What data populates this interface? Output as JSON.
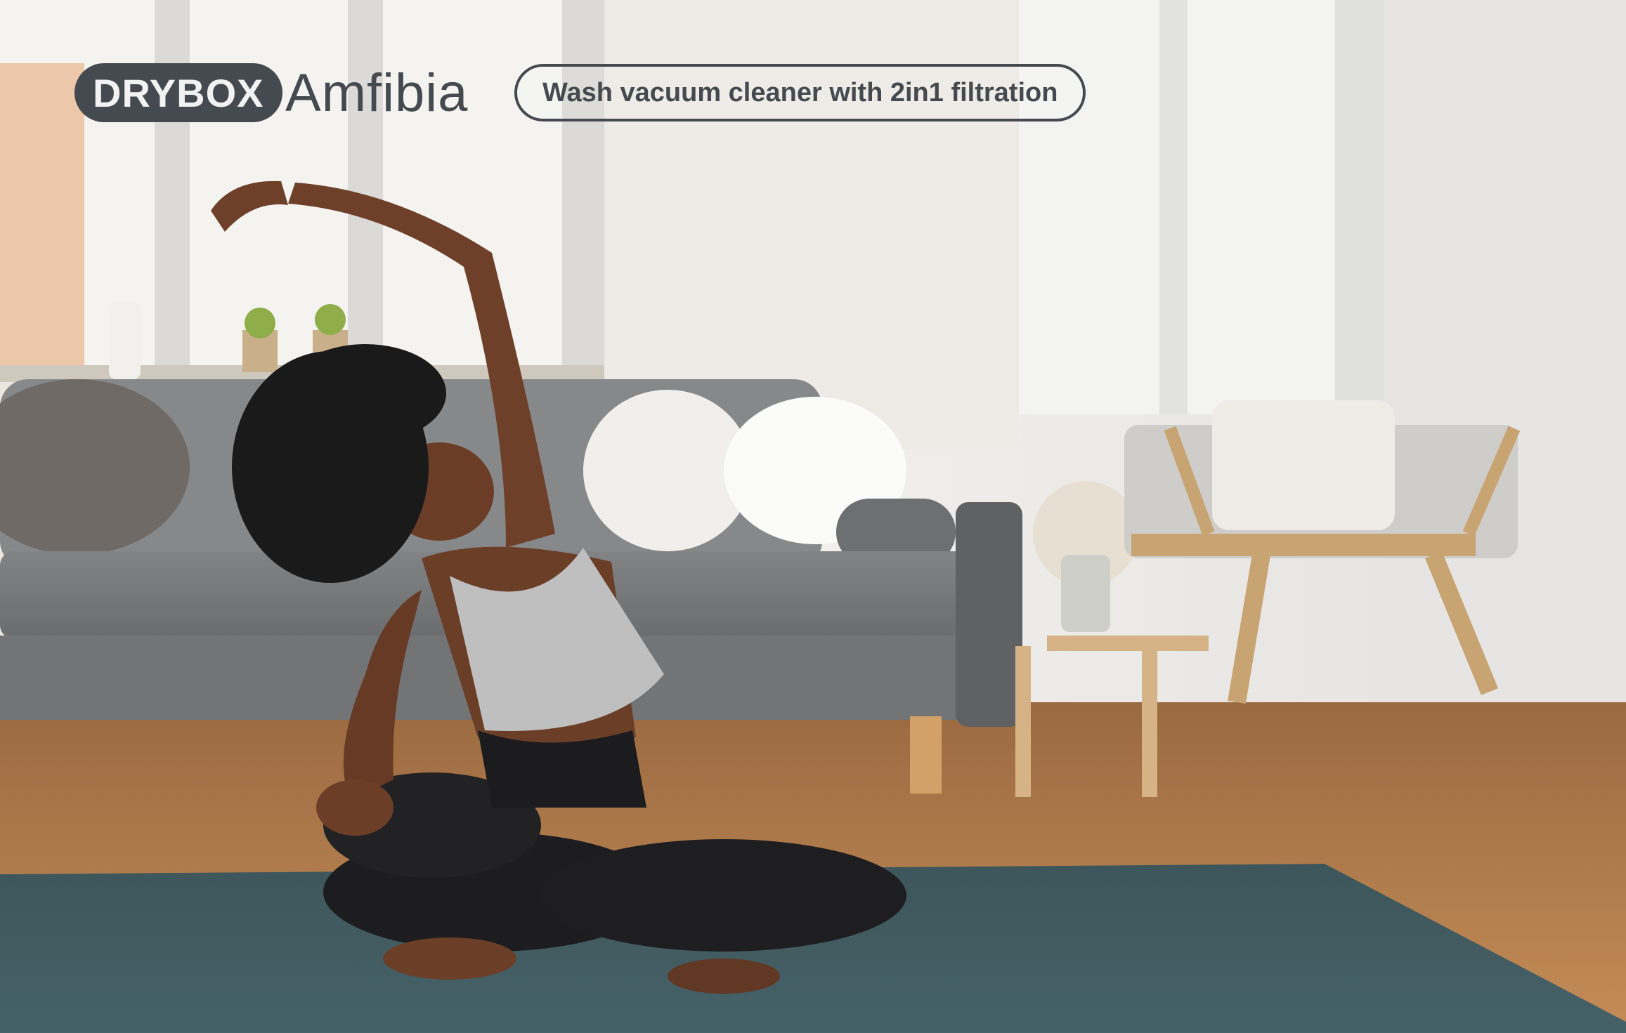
{
  "header": {
    "brand": "DRYBOX",
    "product": "Amfibia",
    "tagline": "Wash vacuum cleaner with 2in1 filtration"
  },
  "colors": {
    "brand_pill_bg": "#454a50",
    "brand_pill_text": "#f2f2f2",
    "text_dark": "#454a50",
    "mat": "#3c5459",
    "floor": "#b07a48",
    "sofa": "#76787a",
    "wall": "#e9e7e3"
  },
  "scene": {
    "icon": "woman-stretching-on-yoga-mat-photo"
  }
}
